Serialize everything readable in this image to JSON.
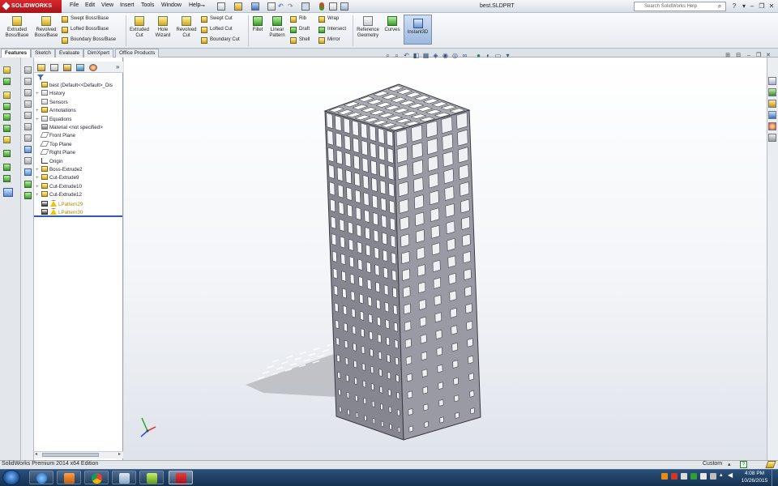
{
  "app": {
    "name": "SOLIDWORKS",
    "document_title": "best.SLDPRT"
  },
  "menu": [
    "File",
    "Edit",
    "View",
    "Insert",
    "Tools",
    "Window",
    "Help"
  ],
  "search": {
    "placeholder": "Search SolidWorks Help"
  },
  "ribbon": {
    "extruded_boss": "Extruded Boss/Base",
    "revolved_boss": "Revolved Boss/Base",
    "swept_boss": "Swept Boss/Base",
    "lofted_boss": "Lofted Boss/Base",
    "boundary_boss": "Boundary Boss/Base",
    "extruded_cut": "Extruded Cut",
    "hole_wizard": "Hole Wizard",
    "revolved_cut": "Revolved Cut",
    "swept_cut": "Swept Cut",
    "lofted_cut": "Lofted Cut",
    "boundary_cut": "Boundary Cut",
    "fillet": "Fillet",
    "linear_pattern": "Linear Pattern",
    "rib": "Rib",
    "draft": "Draft",
    "shell": "Shell",
    "wrap": "Wrap",
    "intersect": "Intersect",
    "mirror": "Mirror",
    "reference_geometry": "Reference Geometry",
    "curves": "Curves",
    "instant3d": "Instant3D"
  },
  "tabs": [
    "Features",
    "Sketch",
    "Evaluate",
    "DimXpert",
    "Office Products"
  ],
  "tree": [
    {
      "label": "best  (Default<<Default>_Dis",
      "expander": "",
      "icon": "part"
    },
    {
      "label": "History",
      "expander": "+",
      "icon": "folder"
    },
    {
      "label": "Sensors",
      "expander": "",
      "icon": "folder"
    },
    {
      "label": "Annotations",
      "expander": "+",
      "icon": "annot"
    },
    {
      "label": "Equations",
      "expander": "+",
      "icon": "annot"
    },
    {
      "label": "Material <not specified>",
      "expander": "",
      "icon": "material"
    },
    {
      "label": "Front Plane",
      "expander": "",
      "icon": "plane"
    },
    {
      "label": "Top Plane",
      "expander": "",
      "icon": "plane"
    },
    {
      "label": "Right Plane",
      "expander": "",
      "icon": "plane"
    },
    {
      "label": "Origin",
      "expander": "",
      "icon": "origin"
    },
    {
      "label": "Boss-Extrude2",
      "expander": "+",
      "icon": "feat"
    },
    {
      "label": "Cut-Extrude9",
      "expander": "+",
      "icon": "feat"
    },
    {
      "label": "Cut-Extrude10",
      "expander": "+",
      "icon": "feat"
    },
    {
      "label": "Cut-Extrude12",
      "expander": "+",
      "icon": "feat"
    },
    {
      "label": "LPattern29",
      "expander": "",
      "icon": "pattern-warn"
    },
    {
      "label": "LPattern30",
      "expander": "",
      "icon": "pattern-warn"
    }
  ],
  "status": {
    "text": "SolidWorks Premium 2014 x64 Edition",
    "units": "Custom",
    "help": "?"
  },
  "clock": {
    "time": "4:08 PM",
    "date": "10/26/2015"
  },
  "colors": {
    "accent": "#d9272e",
    "rollback_bar": "#2b5bb5",
    "model_gray": "#8d8e96",
    "warning": "#f2c200"
  },
  "model": {
    "grid_columns_front": 8,
    "grid_columns_side": 5,
    "grid_rows": 18
  }
}
